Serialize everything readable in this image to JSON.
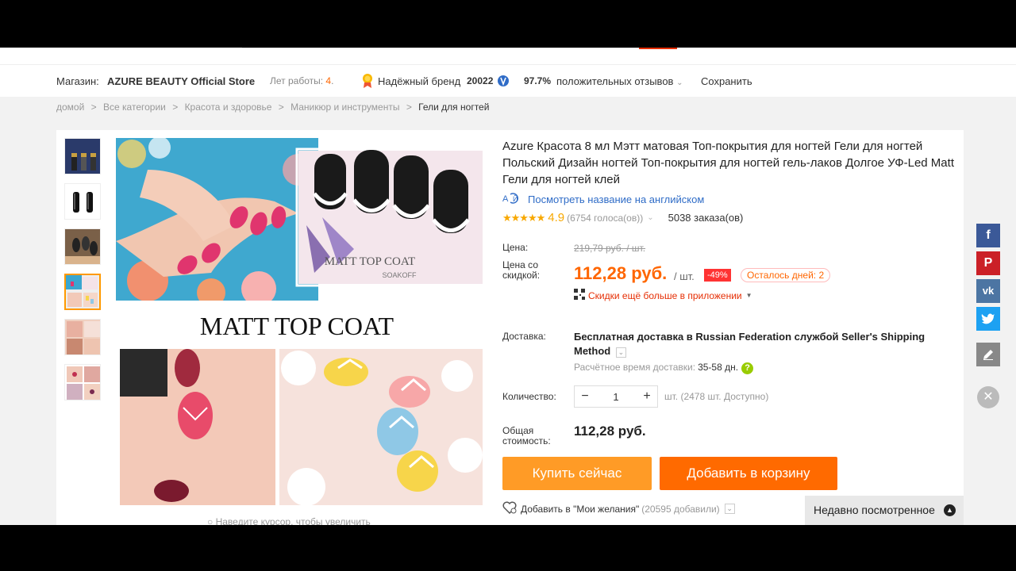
{
  "store": {
    "label": "Магазин:",
    "name": "AZURE BEAUTY Official Store",
    "years_label": "Лет работы:",
    "years_value": "4",
    "years_dot": ".",
    "brand_label": "Надёжный бренд",
    "score": "20022",
    "positive_pct": "97.7%",
    "positive_label": "положительных отзывов",
    "save_label": "Сохранить"
  },
  "breadcrumbs": [
    "домой",
    "Все категории",
    "Красота и здоровье",
    "Маникюр и инструменты",
    "Гели для ногтей"
  ],
  "breadcrumb_sep": ">",
  "gallery": {
    "headline": "MATT TOP COAT",
    "inset_title": "MATT TOP COAT",
    "inset_sub": "SOAKOFF",
    "zoom_hint": "Наведите курсор, чтобы увеличить",
    "thumb_count": 6,
    "active_thumb": 3
  },
  "product": {
    "title": "Azure Красота 8 мл Мэтт матовая Топ-покрытия для ногтей Гели для ногтей Польский Дизайн ногтей Топ-покрытия для ногтей гель-лаков Долгое УФ-Led Matt Гели для ногтей клей",
    "translate_label": "Посмотреть название на английском",
    "stars": "★★★★★",
    "rating": "4.9",
    "votes": "(6754 голоса(ов))",
    "orders": "5038 заказа(ов)",
    "price_label": "Цена:",
    "old_price": "219,79 руб. / шт.",
    "discount_label": "Цена со скидкой:",
    "new_price": "112,28 руб.",
    "unit": "/ шт.",
    "discount_pct": "-49%",
    "days_left": "Осталось дней: 2",
    "app_discount": "Скидки ещё больше в приложении",
    "delivery_label": "Доставка:",
    "delivery_text": "Бесплатная доставка в Russian Federation службой Seller's Shipping Method",
    "delivery_time_label": "Расчётное время доставки:",
    "delivery_time": "35-58 дн.",
    "qty_label": "Количество:",
    "qty_value": "1",
    "qty_minus": "−",
    "qty_plus": "+",
    "available": "шт. (2478 шт. Доступно)",
    "total_label": "Общая стоимость:",
    "total": "112,28 руб.",
    "buy_now": "Купить сейчас",
    "add_to_cart": "Добавить в корзину",
    "wishlist": "Добавить в \"Мои желания\"",
    "wishlist_count": "(20595 добавили)"
  },
  "recent": {
    "label": "Недавно посмотренное"
  },
  "social": {
    "facebook_color": "#3b5998",
    "pinterest_color": "#cb2027",
    "vk_color": "#4c75a3",
    "twitter_color": "#1da1f2",
    "edit_color": "#888888"
  },
  "colors": {
    "accent_orange": "#ff6a00",
    "buy_orange": "#ff9b26",
    "price": "#ff6600",
    "link": "#2f6cc7"
  }
}
